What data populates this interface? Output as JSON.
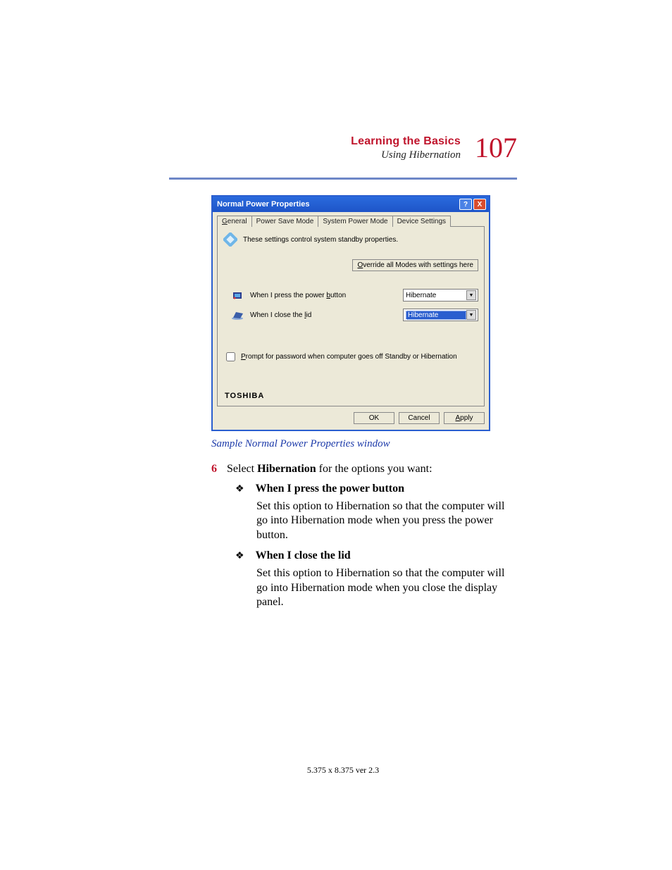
{
  "header": {
    "chapter": "Learning the Basics",
    "section": "Using Hibernation",
    "page_number": "107"
  },
  "dialog": {
    "title": "Normal Power Properties",
    "tabs": {
      "general": "General",
      "power_save": "Power Save Mode",
      "system_power": "System Power Mode",
      "device_settings": "Device Settings"
    },
    "description": "These settings control system standby properties.",
    "override_btn": "Override all Modes with settings here",
    "field_power_button": "When I press the power button",
    "field_power_button_value": "Hibernate",
    "field_close_lid": "When I close the lid",
    "field_close_lid_value": "Hibernate",
    "checkbox_label": "Prompt for password when computer goes off Standby or Hibernation",
    "brand": "TOSHIBA",
    "btn_ok": "OK",
    "btn_cancel": "Cancel",
    "btn_apply": "Apply"
  },
  "caption": "Sample Normal Power Properties window",
  "step": {
    "number": "6",
    "text_before": "Select ",
    "text_bold": "Hibernation",
    "text_after": " for the options you want:"
  },
  "bullets": {
    "b1": {
      "head": "When I press the power button",
      "body": "Set this option to Hibernation so that the computer will go into Hibernation mode when you press the power button."
    },
    "b2": {
      "head": "When I close the lid",
      "body": "Set this option to Hibernation so that the computer will go into Hibernation mode when you close the display panel."
    }
  },
  "footer": "5.375 x 8.375  ver 2.3"
}
